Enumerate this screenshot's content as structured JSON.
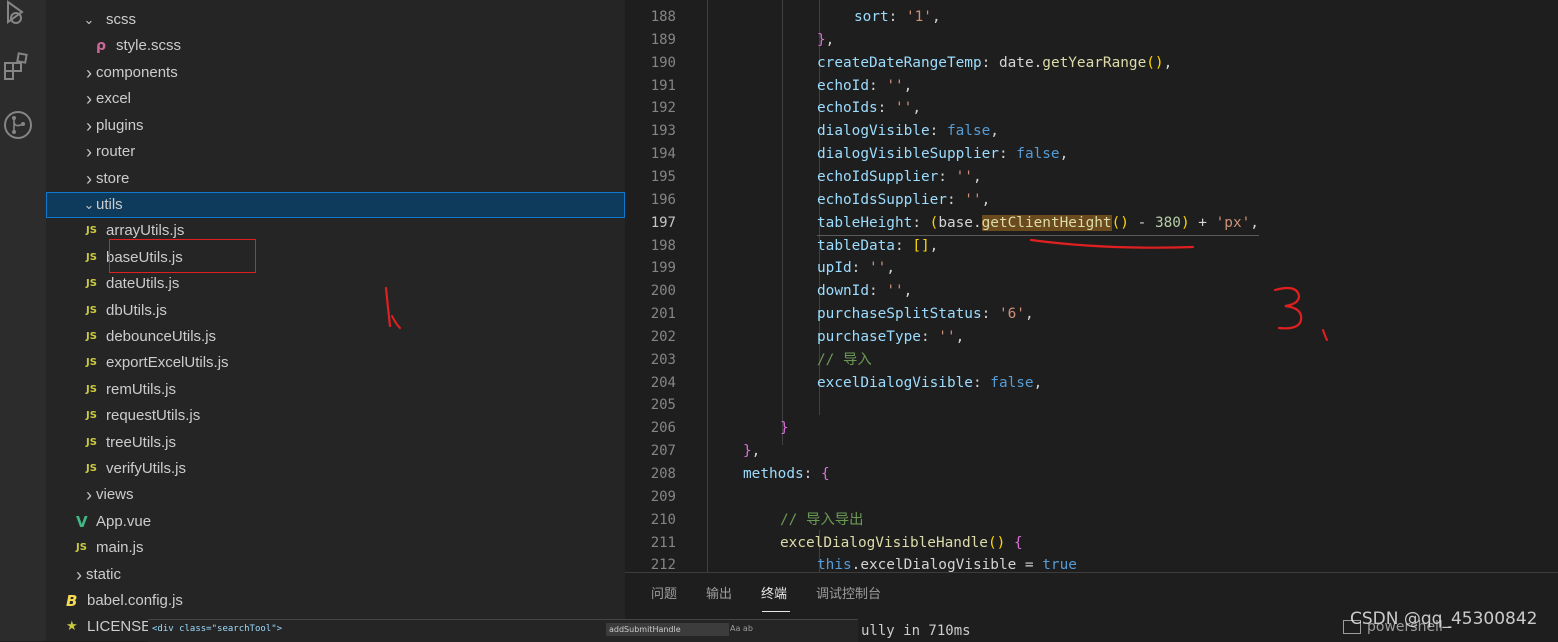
{
  "explorer": {
    "rows": [
      {
        "label": "scss",
        "icon": "chevron-down-icon"
      },
      {
        "label": "style.scss",
        "icon": "scss-file-icon"
      },
      {
        "label": "components",
        "icon": "chevron-right-icon"
      },
      {
        "label": "excel",
        "icon": "chevron-right-icon"
      },
      {
        "label": "plugins",
        "icon": "chevron-right-icon"
      },
      {
        "label": "router",
        "icon": "chevron-right-icon"
      },
      {
        "label": "store",
        "icon": "chevron-right-icon"
      },
      {
        "label": "utils",
        "icon": "chevron-down-icon"
      },
      {
        "label": "arrayUtils.js",
        "badge": "JS"
      },
      {
        "label": "baseUtils.js",
        "badge": "JS"
      },
      {
        "label": "dateUtils.js",
        "badge": "JS"
      },
      {
        "label": "dbUtils.js",
        "badge": "JS"
      },
      {
        "label": "debounceUtils.js",
        "badge": "JS"
      },
      {
        "label": "exportExcelUtils.js",
        "badge": "JS"
      },
      {
        "label": "remUtils.js",
        "badge": "JS"
      },
      {
        "label": "requestUtils.js",
        "badge": "JS"
      },
      {
        "label": "treeUtils.js",
        "badge": "JS"
      },
      {
        "label": "verifyUtils.js",
        "badge": "JS"
      },
      {
        "label": "views",
        "icon": "chevron-right-icon"
      },
      {
        "label": "App.vue",
        "badge": "V"
      },
      {
        "label": "main.js",
        "badge": "JS"
      },
      {
        "label": "static",
        "icon": "chevron-right-icon"
      },
      {
        "label": "babel.config.js",
        "icon": "babel-icon"
      },
      {
        "label": "LICENSE",
        "icon": "license-icon"
      }
    ]
  },
  "editor": {
    "active_line": "197",
    "lines": [
      {
        "n": "188",
        "text": "sort: '1',"
      },
      {
        "n": "189",
        "text": "},"
      },
      {
        "n": "190",
        "text": "createDateRangeTemp: date.getYearRange(),"
      },
      {
        "n": "191",
        "text": "echoId: '',"
      },
      {
        "n": "192",
        "text": "echoIds: '',"
      },
      {
        "n": "193",
        "text": "dialogVisible: false,"
      },
      {
        "n": "194",
        "text": "dialogVisibleSupplier: false,"
      },
      {
        "n": "195",
        "text": "echoIdSupplier: '',"
      },
      {
        "n": "196",
        "text": "echoIdsSupplier: '',"
      },
      {
        "n": "197",
        "text": "tableHeight: (base.getClientHeight() - 380) + 'px',"
      },
      {
        "n": "198",
        "text": "tableData: [],"
      },
      {
        "n": "199",
        "text": "upId: '',"
      },
      {
        "n": "200",
        "text": "downId: '',"
      },
      {
        "n": "201",
        "text": "purchaseSplitStatus: '6',"
      },
      {
        "n": "202",
        "text": "purchaseType: '',"
      },
      {
        "n": "203",
        "text": "// 导入"
      },
      {
        "n": "204",
        "text": "excelDialogVisible: false,"
      },
      {
        "n": "205",
        "text": ""
      },
      {
        "n": "206",
        "text": "}"
      },
      {
        "n": "207",
        "text": "},"
      },
      {
        "n": "208",
        "text": "methods: {"
      },
      {
        "n": "209",
        "text": ""
      },
      {
        "n": "210",
        "text": "// 导入导出"
      },
      {
        "n": "211",
        "text": "excelDialogVisibleHandle() {"
      },
      {
        "n": "212",
        "text": "this.excelDialogVisible = true"
      }
    ]
  },
  "panel": {
    "tabs": [
      "问题",
      "输出",
      "终端",
      "调试控制台"
    ],
    "active_tab": "终端",
    "terminal_text": "ully in 710ms",
    "terminal_name": "powershell -",
    "watermark": "CSDN @qq_45300842"
  },
  "popup": {
    "code_text": "<div class=\"searchTool\">",
    "search_value": "addSubmitHandle",
    "search_options": "Aa ab"
  },
  "annotations": [
    "1、",
    "3、"
  ],
  "colors": {
    "annotation": "#e02020",
    "selection": "#0e3a5c",
    "js_badge": "#cbcb41",
    "vue_badge": "#41b883"
  }
}
